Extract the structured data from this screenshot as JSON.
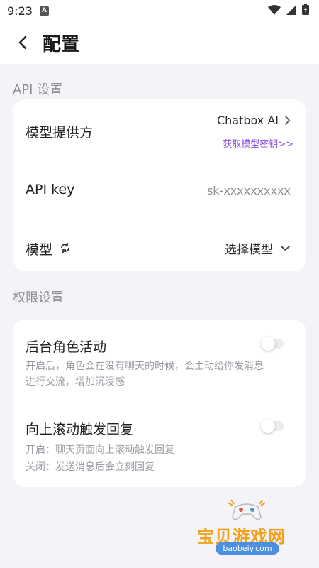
{
  "status_bar": {
    "time": "9:23",
    "notification_letter": "A"
  },
  "header": {
    "title": "配置"
  },
  "api_section": {
    "title": "API 设置",
    "provider": {
      "label": "模型提供方",
      "value": "Chatbox AI",
      "link": "获取模型密钥>>"
    },
    "api_key": {
      "label": "API key",
      "value": "sk-xxxxxxxxxx"
    },
    "model": {
      "label": "模型",
      "value": "选择模型"
    }
  },
  "permission_section": {
    "title": "权限设置",
    "background_activity": {
      "label": "后台角色活动",
      "desc_line1": "开启后，角色会在没有聊天的时候，会主动给你发消息",
      "desc_line2": "进行交流，增加沉浸感",
      "enabled": false
    },
    "scroll_reply": {
      "label": "向上滚动触发回复",
      "desc_line1": "开启：聊天页面向上滚动触发回复",
      "desc_line2": "关闭：发送消息后会立刻回复",
      "enabled": false
    }
  },
  "watermark": {
    "title": "宝贝游戏网",
    "url": "baobeiy.com"
  },
  "colors": {
    "accent": "#8a52e0",
    "background": "#f4f3f7",
    "card": "#ffffff",
    "watermark": "#f0a21a"
  }
}
